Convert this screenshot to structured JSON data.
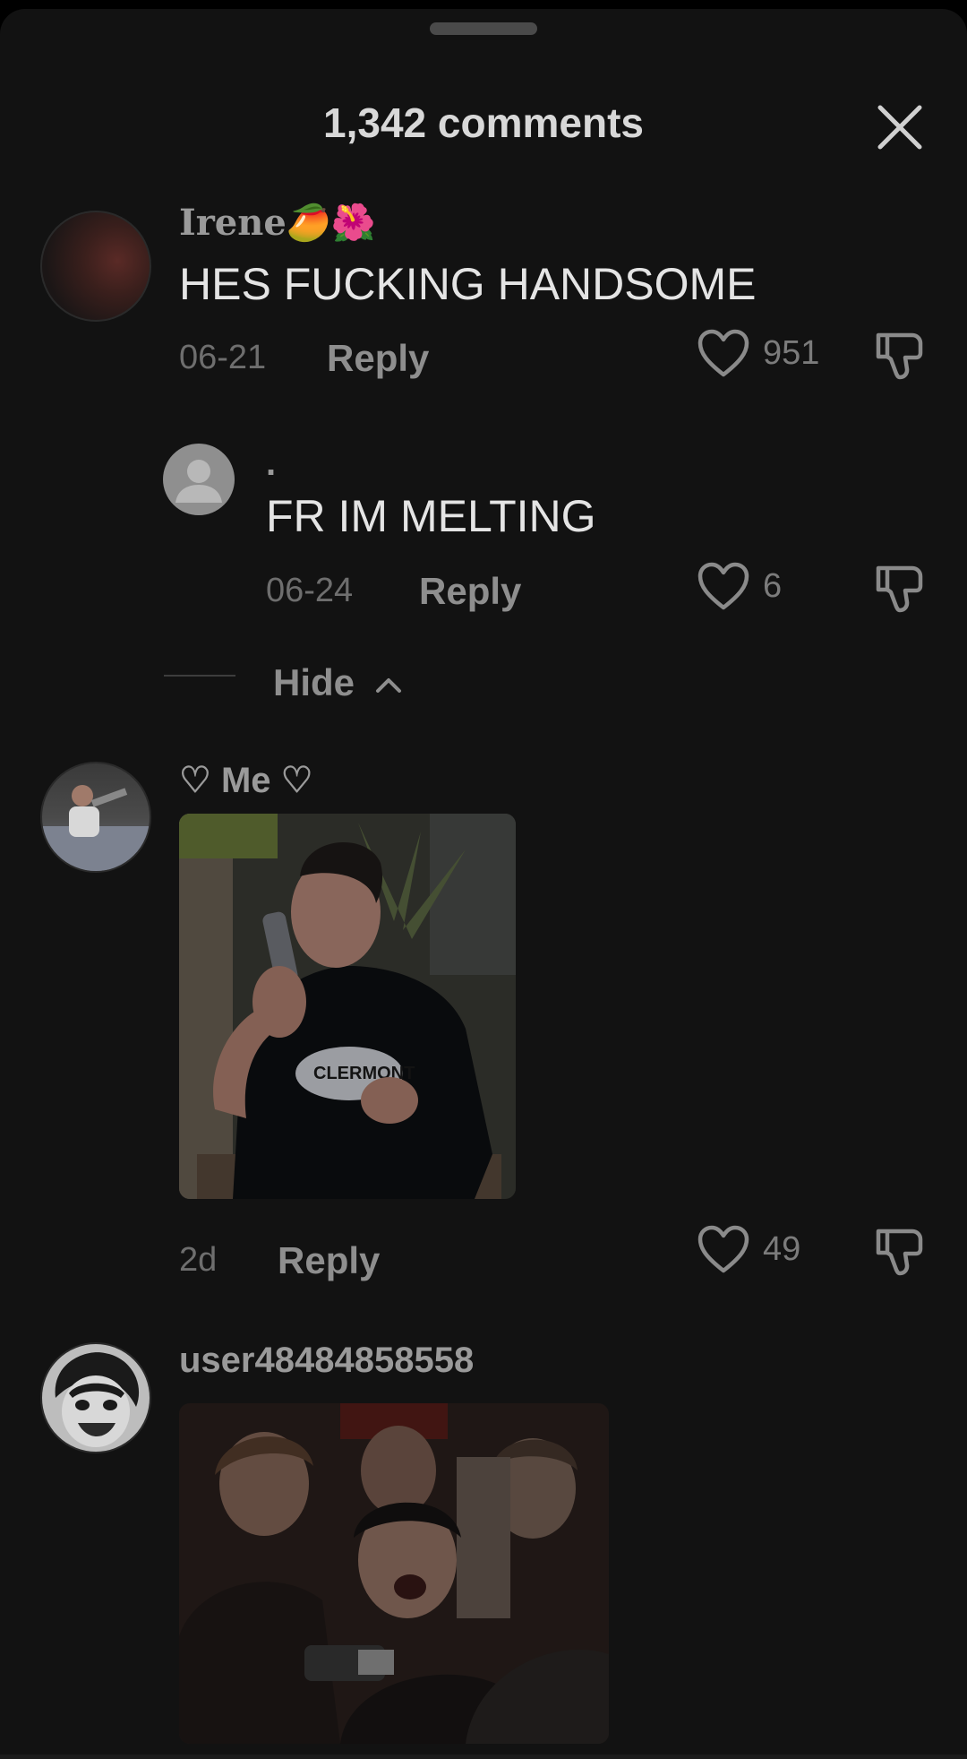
{
  "header": {
    "title": "1,342 comments"
  },
  "comments": [
    {
      "username": "Irene🥭🌺",
      "text": "HES FUCKING HANDSOME",
      "date": "06-21",
      "reply_label": "Reply",
      "likes": "951"
    },
    {
      "username": ".",
      "text": "FR IM MELTING",
      "date": "06-24",
      "reply_label": "Reply",
      "likes": "6"
    },
    {
      "username": "♡ Me ♡",
      "text": "",
      "date": "2d",
      "reply_label": "Reply",
      "likes": "49"
    },
    {
      "username": "user48484858558",
      "text": "",
      "date": "",
      "reply_label": "",
      "likes": ""
    }
  ],
  "replies_toggle": {
    "label": "Hide"
  },
  "icons": {
    "close": "close-icon",
    "like": "heart-icon",
    "dislike": "thumbs-down-icon",
    "toggle": "chevron-up-icon"
  },
  "colors": {
    "background": "#121212",
    "text_primary": "#e4e4e4",
    "text_secondary": "#8e8e8e"
  }
}
